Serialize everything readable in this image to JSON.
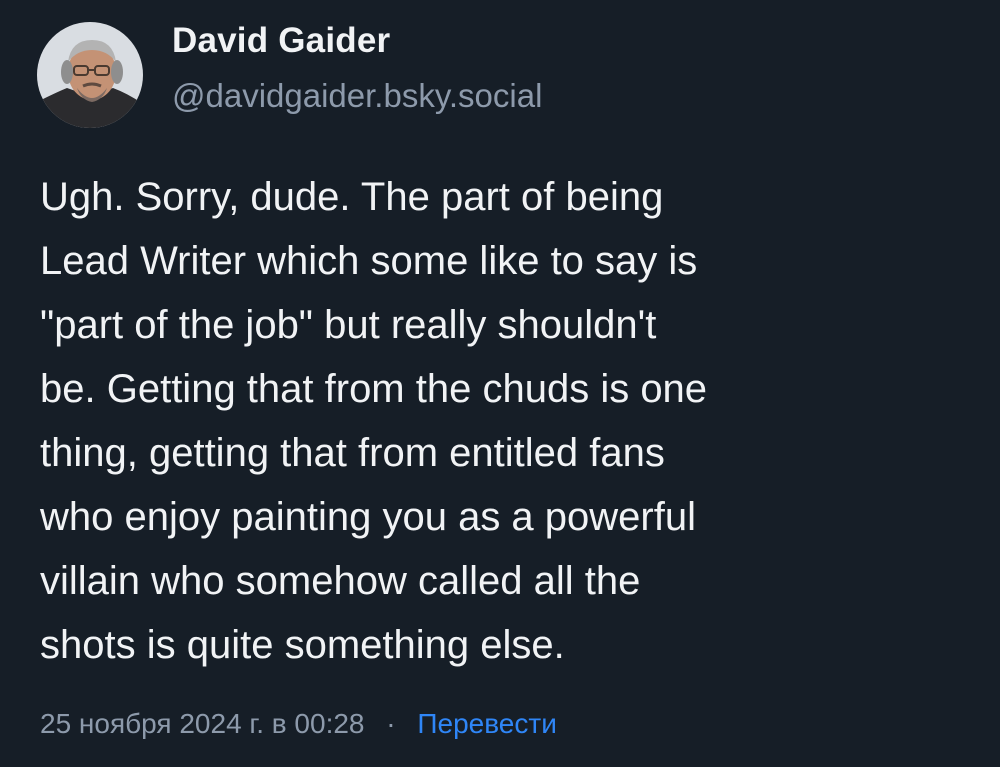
{
  "author": {
    "display_name": "David Gaider",
    "handle": "@davidgaider.bsky.social",
    "avatar_icon": "user-avatar"
  },
  "post": {
    "text": "Ugh. Sorry, dude. The part of being\nLead Writer which some like to say is\n\"part of the job\" but really shouldn't\nbe. Getting that from the chuds is one\nthing, getting that from entitled fans\nwho enjoy painting you as a powerful\nvillain who somehow called all the\nshots is quite something else."
  },
  "meta": {
    "timestamp": "25 ноября 2024 г. в 00:28",
    "separator": "·",
    "translate_label": "Перевести"
  },
  "colors": {
    "background": "#161e27",
    "text": "#f1f3f5",
    "muted": "#8d9aab",
    "link": "#2f86f7"
  }
}
